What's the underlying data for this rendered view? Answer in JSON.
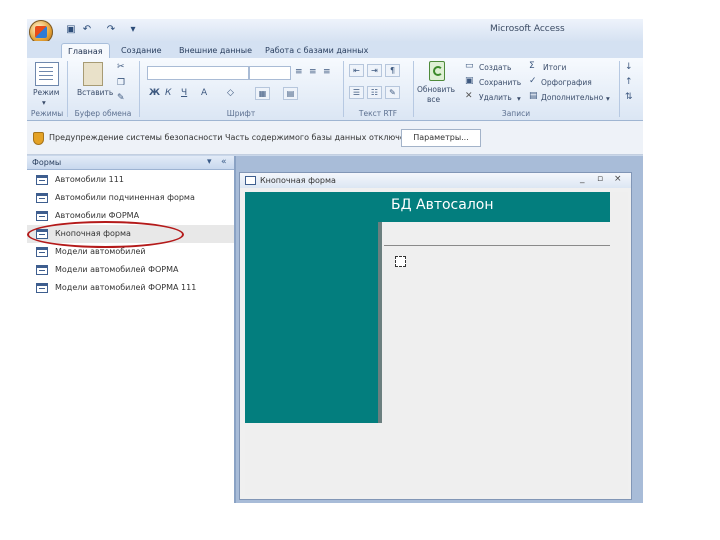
{
  "window": {
    "app_title": "Microsoft Access"
  },
  "ribbon": {
    "tabs": [
      "Главная",
      "Создание",
      "Внешние данные",
      "Работа с базами данных"
    ],
    "groups": [
      "Режимы",
      "Буфер обмена",
      "Шрифт",
      "Текст RTF",
      "Записи"
    ],
    "view_label": "Режим",
    "paste_label": "Вставить",
    "refresh_label": "Обновить",
    "refresh_sub": "все",
    "records": {
      "create": "Создать",
      "save": "Сохранить",
      "delete": "Удалить",
      "totals": "Итоги",
      "spelling": "Орфография",
      "more": "Дополнительно"
    }
  },
  "security_bar": {
    "message": "Предупреждение системы безопасности   Часть содержимого базы данных отключено",
    "options_button": "Параметры..."
  },
  "nav_pane": {
    "title": "Формы",
    "items": [
      "Автомобили 111",
      "Автомобили подчиненная форма",
      "Автомобили ФОРМА",
      "Кнопочная форма",
      "Модели автомобилей",
      "Модели автомобилей ФОРМА",
      "Модели автомобилей ФОРМА 111"
    ],
    "selected_index": 3
  },
  "form_window": {
    "title": "Кнопочная форма",
    "heading": "БД Автосалон"
  },
  "colors": {
    "form_teal": "#037e7e",
    "annotation_red": "#b41a1a"
  }
}
